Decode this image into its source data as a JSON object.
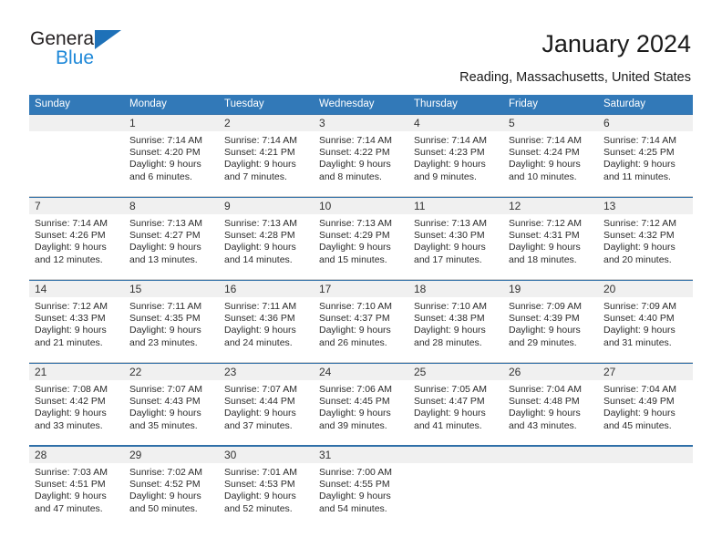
{
  "brand": {
    "line1": "General",
    "line2": "Blue",
    "triangle_color": "#1e71b8",
    "line2_color": "#1e88d8"
  },
  "header": {
    "title": "January 2024",
    "subtitle": "Reading, Massachusetts, United States"
  },
  "theme": {
    "header_bg": "#3279b8",
    "date_band_bg": "#f0f0f0",
    "separator": "#d0d0d0"
  },
  "weekdays": [
    "Sunday",
    "Monday",
    "Tuesday",
    "Wednesday",
    "Thursday",
    "Friday",
    "Saturday"
  ],
  "weeks": [
    [
      {
        "date": "",
        "sunrise": "",
        "sunset": "",
        "daylight1": "",
        "daylight2": ""
      },
      {
        "date": "1",
        "sunrise": "Sunrise: 7:14 AM",
        "sunset": "Sunset: 4:20 PM",
        "daylight1": "Daylight: 9 hours",
        "daylight2": "and 6 minutes."
      },
      {
        "date": "2",
        "sunrise": "Sunrise: 7:14 AM",
        "sunset": "Sunset: 4:21 PM",
        "daylight1": "Daylight: 9 hours",
        "daylight2": "and 7 minutes."
      },
      {
        "date": "3",
        "sunrise": "Sunrise: 7:14 AM",
        "sunset": "Sunset: 4:22 PM",
        "daylight1": "Daylight: 9 hours",
        "daylight2": "and 8 minutes."
      },
      {
        "date": "4",
        "sunrise": "Sunrise: 7:14 AM",
        "sunset": "Sunset: 4:23 PM",
        "daylight1": "Daylight: 9 hours",
        "daylight2": "and 9 minutes."
      },
      {
        "date": "5",
        "sunrise": "Sunrise: 7:14 AM",
        "sunset": "Sunset: 4:24 PM",
        "daylight1": "Daylight: 9 hours",
        "daylight2": "and 10 minutes."
      },
      {
        "date": "6",
        "sunrise": "Sunrise: 7:14 AM",
        "sunset": "Sunset: 4:25 PM",
        "daylight1": "Daylight: 9 hours",
        "daylight2": "and 11 minutes."
      }
    ],
    [
      {
        "date": "7",
        "sunrise": "Sunrise: 7:14 AM",
        "sunset": "Sunset: 4:26 PM",
        "daylight1": "Daylight: 9 hours",
        "daylight2": "and 12 minutes."
      },
      {
        "date": "8",
        "sunrise": "Sunrise: 7:13 AM",
        "sunset": "Sunset: 4:27 PM",
        "daylight1": "Daylight: 9 hours",
        "daylight2": "and 13 minutes."
      },
      {
        "date": "9",
        "sunrise": "Sunrise: 7:13 AM",
        "sunset": "Sunset: 4:28 PM",
        "daylight1": "Daylight: 9 hours",
        "daylight2": "and 14 minutes."
      },
      {
        "date": "10",
        "sunrise": "Sunrise: 7:13 AM",
        "sunset": "Sunset: 4:29 PM",
        "daylight1": "Daylight: 9 hours",
        "daylight2": "and 15 minutes."
      },
      {
        "date": "11",
        "sunrise": "Sunrise: 7:13 AM",
        "sunset": "Sunset: 4:30 PM",
        "daylight1": "Daylight: 9 hours",
        "daylight2": "and 17 minutes."
      },
      {
        "date": "12",
        "sunrise": "Sunrise: 7:12 AM",
        "sunset": "Sunset: 4:31 PM",
        "daylight1": "Daylight: 9 hours",
        "daylight2": "and 18 minutes."
      },
      {
        "date": "13",
        "sunrise": "Sunrise: 7:12 AM",
        "sunset": "Sunset: 4:32 PM",
        "daylight1": "Daylight: 9 hours",
        "daylight2": "and 20 minutes."
      }
    ],
    [
      {
        "date": "14",
        "sunrise": "Sunrise: 7:12 AM",
        "sunset": "Sunset: 4:33 PM",
        "daylight1": "Daylight: 9 hours",
        "daylight2": "and 21 minutes."
      },
      {
        "date": "15",
        "sunrise": "Sunrise: 7:11 AM",
        "sunset": "Sunset: 4:35 PM",
        "daylight1": "Daylight: 9 hours",
        "daylight2": "and 23 minutes."
      },
      {
        "date": "16",
        "sunrise": "Sunrise: 7:11 AM",
        "sunset": "Sunset: 4:36 PM",
        "daylight1": "Daylight: 9 hours",
        "daylight2": "and 24 minutes."
      },
      {
        "date": "17",
        "sunrise": "Sunrise: 7:10 AM",
        "sunset": "Sunset: 4:37 PM",
        "daylight1": "Daylight: 9 hours",
        "daylight2": "and 26 minutes."
      },
      {
        "date": "18",
        "sunrise": "Sunrise: 7:10 AM",
        "sunset": "Sunset: 4:38 PM",
        "daylight1": "Daylight: 9 hours",
        "daylight2": "and 28 minutes."
      },
      {
        "date": "19",
        "sunrise": "Sunrise: 7:09 AM",
        "sunset": "Sunset: 4:39 PM",
        "daylight1": "Daylight: 9 hours",
        "daylight2": "and 29 minutes."
      },
      {
        "date": "20",
        "sunrise": "Sunrise: 7:09 AM",
        "sunset": "Sunset: 4:40 PM",
        "daylight1": "Daylight: 9 hours",
        "daylight2": "and 31 minutes."
      }
    ],
    [
      {
        "date": "21",
        "sunrise": "Sunrise: 7:08 AM",
        "sunset": "Sunset: 4:42 PM",
        "daylight1": "Daylight: 9 hours",
        "daylight2": "and 33 minutes."
      },
      {
        "date": "22",
        "sunrise": "Sunrise: 7:07 AM",
        "sunset": "Sunset: 4:43 PM",
        "daylight1": "Daylight: 9 hours",
        "daylight2": "and 35 minutes."
      },
      {
        "date": "23",
        "sunrise": "Sunrise: 7:07 AM",
        "sunset": "Sunset: 4:44 PM",
        "daylight1": "Daylight: 9 hours",
        "daylight2": "and 37 minutes."
      },
      {
        "date": "24",
        "sunrise": "Sunrise: 7:06 AM",
        "sunset": "Sunset: 4:45 PM",
        "daylight1": "Daylight: 9 hours",
        "daylight2": "and 39 minutes."
      },
      {
        "date": "25",
        "sunrise": "Sunrise: 7:05 AM",
        "sunset": "Sunset: 4:47 PM",
        "daylight1": "Daylight: 9 hours",
        "daylight2": "and 41 minutes."
      },
      {
        "date": "26",
        "sunrise": "Sunrise: 7:04 AM",
        "sunset": "Sunset: 4:48 PM",
        "daylight1": "Daylight: 9 hours",
        "daylight2": "and 43 minutes."
      },
      {
        "date": "27",
        "sunrise": "Sunrise: 7:04 AM",
        "sunset": "Sunset: 4:49 PM",
        "daylight1": "Daylight: 9 hours",
        "daylight2": "and 45 minutes."
      }
    ],
    [
      {
        "date": "28",
        "sunrise": "Sunrise: 7:03 AM",
        "sunset": "Sunset: 4:51 PM",
        "daylight1": "Daylight: 9 hours",
        "daylight2": "and 47 minutes."
      },
      {
        "date": "29",
        "sunrise": "Sunrise: 7:02 AM",
        "sunset": "Sunset: 4:52 PM",
        "daylight1": "Daylight: 9 hours",
        "daylight2": "and 50 minutes."
      },
      {
        "date": "30",
        "sunrise": "Sunrise: 7:01 AM",
        "sunset": "Sunset: 4:53 PM",
        "daylight1": "Daylight: 9 hours",
        "daylight2": "and 52 minutes."
      },
      {
        "date": "31",
        "sunrise": "Sunrise: 7:00 AM",
        "sunset": "Sunset: 4:55 PM",
        "daylight1": "Daylight: 9 hours",
        "daylight2": "and 54 minutes."
      },
      {
        "date": "",
        "sunrise": "",
        "sunset": "",
        "daylight1": "",
        "daylight2": ""
      },
      {
        "date": "",
        "sunrise": "",
        "sunset": "",
        "daylight1": "",
        "daylight2": ""
      },
      {
        "date": "",
        "sunrise": "",
        "sunset": "",
        "daylight1": "",
        "daylight2": ""
      }
    ]
  ]
}
